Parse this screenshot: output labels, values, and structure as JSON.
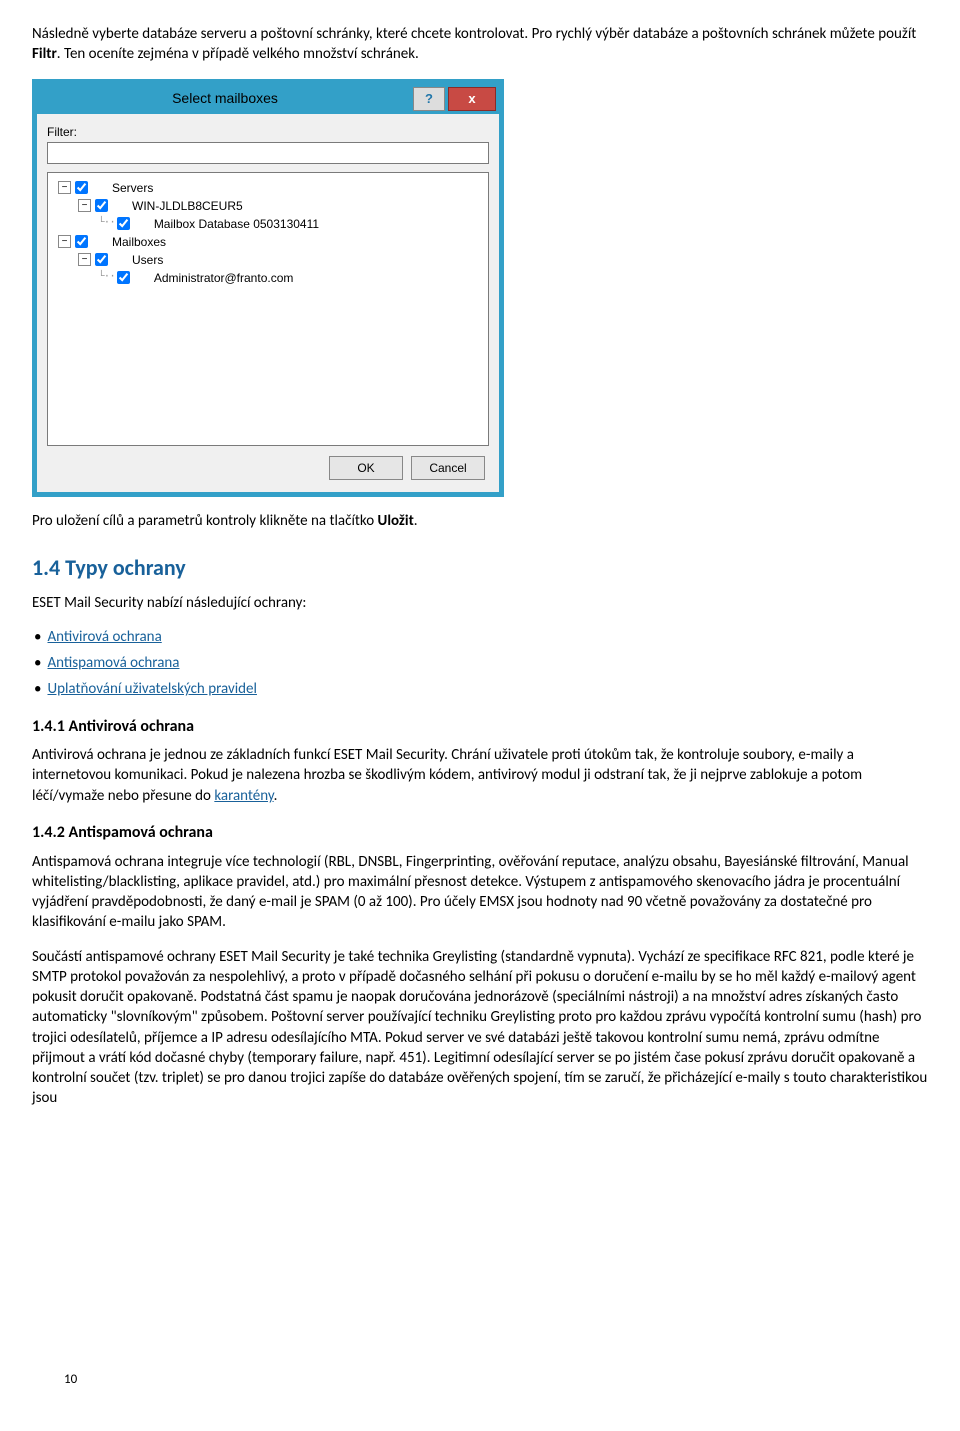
{
  "intro": {
    "para1_a": "Následně vyberte databáze serveru a poštovní schránky, které chcete kontrolovat. Pro rychlý výběr databáze a poštovních schránek můžete použít ",
    "para1_b": "Filtr",
    "para1_c": ". Ten oceníte zejména v případě velkého množství schránek."
  },
  "dialog": {
    "title": "Select mailboxes",
    "help_icon": "?",
    "close_icon": "x",
    "filter_label": "Filter:",
    "filter_value": "",
    "tree": {
      "servers": "Servers",
      "server_name": "WIN-JLDLB8CEUR5",
      "mailbox_db": "Mailbox Database 0503130411",
      "mailboxes": "Mailboxes",
      "users": "Users",
      "admin_email": "Administrator@franto.com"
    },
    "ok": "OK",
    "cancel": "Cancel"
  },
  "after_dialog": {
    "text_a": "Pro uložení cílů a parametrů kontroly klikněte na tlačítko ",
    "text_b": "Uložit",
    "text_c": "."
  },
  "sec14": {
    "heading": "1.4   Typy ochrany",
    "intro": "ESET Mail Security nabízí následující ochrany:",
    "items": {
      "a": "Antivirová ochrana",
      "b": "Antispamová ochrana",
      "c": "Uplatňování uživatelských pravidel"
    }
  },
  "sec141": {
    "heading": "1.4.1   Antivirová ochrana",
    "para_a": "Antivirová ochrana je jednou ze základních funkcí ESET Mail Security. Chrání uživatele proti útokům tak, že kontroluje soubory, e-maily a internetovou komunikaci. Pokud je nalezena hrozba se škodlivým kódem, antivirový modul ji odstraní tak, že ji nejprve zablokuje a potom léčí/vymaže nebo přesune do ",
    "link": "karantény",
    "para_b": "."
  },
  "sec142": {
    "heading": "1.4.2   Antispamová ochrana",
    "para1": "Antispamová ochrana integruje více technologií (RBL, DNSBL, Fingerprinting, ověřování reputace, analýzu obsahu, Bayesiánské filtrování, Manual whitelisting/blacklisting, aplikace pravidel, atd.) pro maximální přesnost detekce. Výstupem z antispamového skenovacího jádra je procentuální vyjádření pravděpodobnosti, že daný e-mail je SPAM (0 až 100). Pro účely EMSX jsou hodnoty nad 90 včetně považovány za dostatečné pro klasifikování e-mailu jako SPAM.",
    "para2": "Součástí antispamové ochrany ESET Mail Security je také technika Greylisting (standardně vypnuta). Vychází ze specifikace RFC 821, podle které je SMTP protokol považován za nespolehlivý, a proto v případě dočasného selhání při pokusu o doručení e-mailu by se ho měl každý e-mailový agent pokusit doručit opakovaně. Podstatná část spamu je naopak doručována jednorázově (speciálními nástroji) a na množství adres získaných často automaticky \"slovníkovým\" způsobem. Poštovní server používající techniku Greylisting proto pro každou zprávu vypočítá kontrolní sumu (hash) pro trojici odesílatelů, příjemce a IP adresu odesílajícího MTA. Pokud server ve své databázi ještě takovou kontrolní sumu nemá, zprávu odmítne přijmout a vrátí kód dočasné chyby (temporary failure, např. 451). Legitimní odesílající server se po jistém čase pokusí zprávu doručit opakovaně a kontrolní součet (tzv. triplet) se pro danou trojici zapíše do databáze ověřených spojení, tím se zaručí, že přicházející e-maily s touto charakteristikou jsou"
  },
  "pagenum": "10"
}
